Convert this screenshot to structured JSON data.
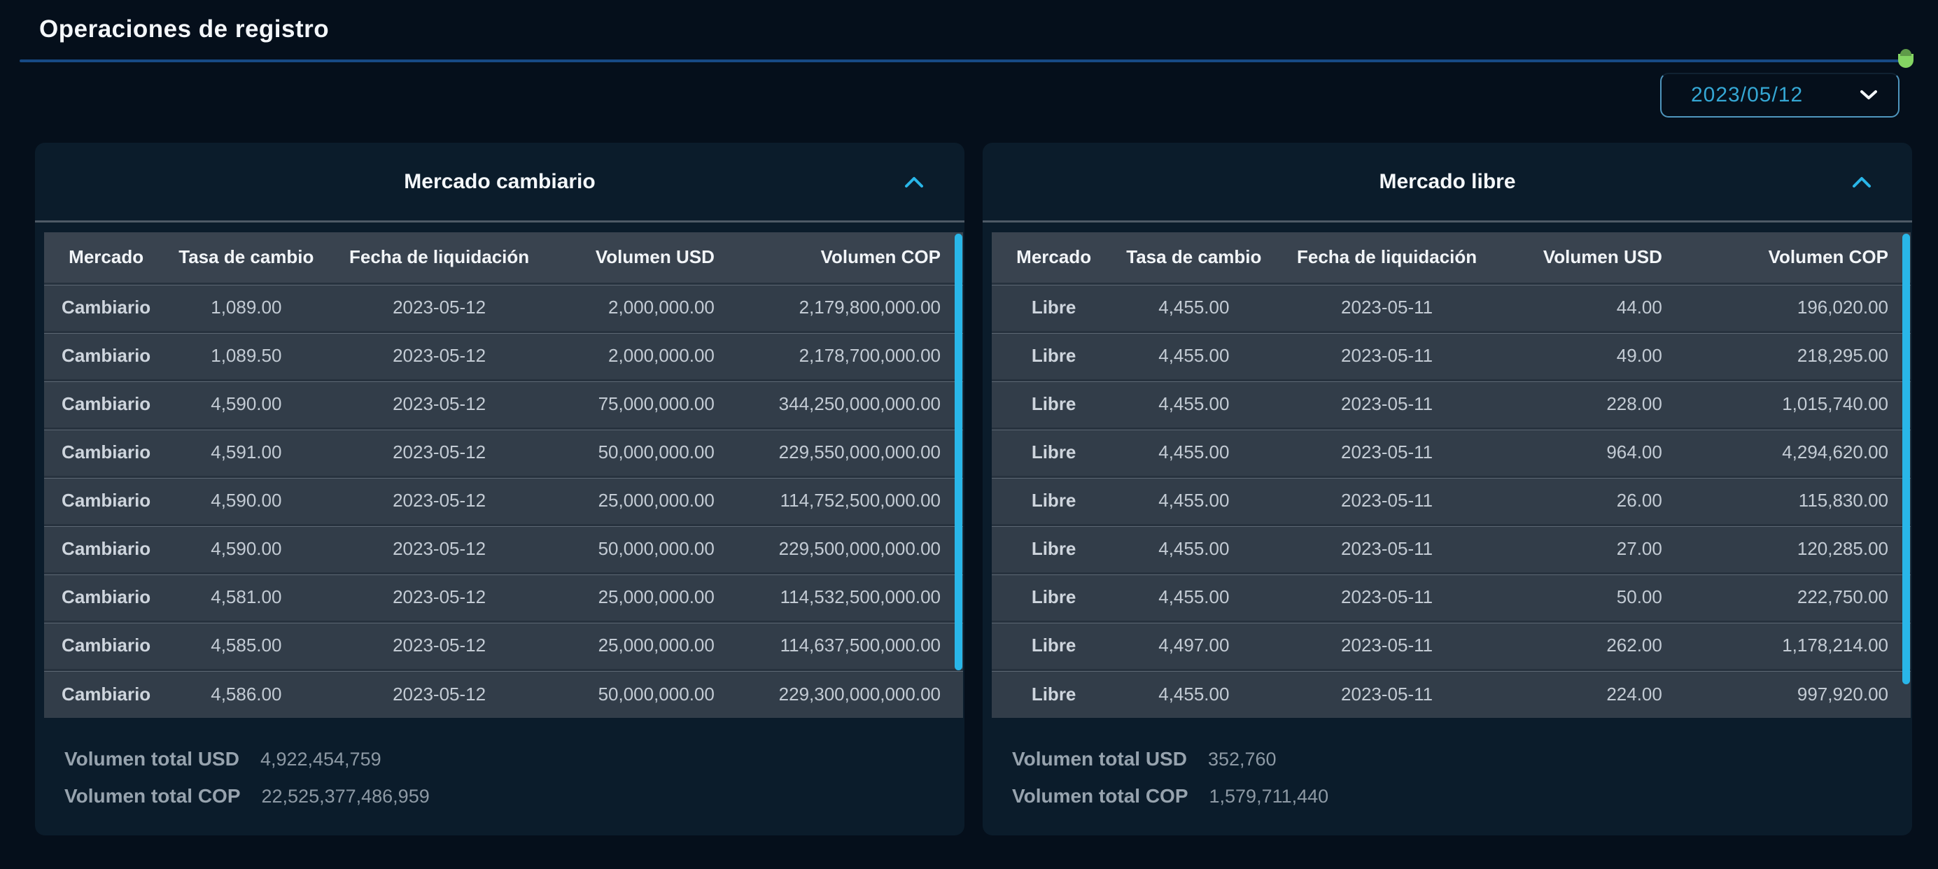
{
  "page": {
    "title": "Operaciones de registro"
  },
  "date_selector": {
    "value": "2023/05/12"
  },
  "columns": [
    "Mercado",
    "Tasa de cambio",
    "Fecha de liquidación",
    "Volumen USD",
    "Volumen COP"
  ],
  "panels": [
    {
      "title": "Mercado cambiario",
      "rows": [
        [
          "Cambiario",
          "1,089.00",
          "2023-05-12",
          "2,000,000.00",
          "2,179,800,000.00"
        ],
        [
          "Cambiario",
          "1,089.50",
          "2023-05-12",
          "2,000,000.00",
          "2,178,700,000.00"
        ],
        [
          "Cambiario",
          "4,590.00",
          "2023-05-12",
          "75,000,000.00",
          "344,250,000,000.00"
        ],
        [
          "Cambiario",
          "4,591.00",
          "2023-05-12",
          "50,000,000.00",
          "229,550,000,000.00"
        ],
        [
          "Cambiario",
          "4,590.00",
          "2023-05-12",
          "25,000,000.00",
          "114,752,500,000.00"
        ],
        [
          "Cambiario",
          "4,590.00",
          "2023-05-12",
          "50,000,000.00",
          "229,500,000,000.00"
        ],
        [
          "Cambiario",
          "4,581.00",
          "2023-05-12",
          "25,000,000.00",
          "114,532,500,000.00"
        ],
        [
          "Cambiario",
          "4,585.00",
          "2023-05-12",
          "25,000,000.00",
          "114,637,500,000.00"
        ],
        [
          "Cambiario",
          "4,586.00",
          "2023-05-12",
          "50,000,000.00",
          "229,300,000,000.00"
        ]
      ],
      "totals": {
        "usd_label": "Volumen total USD",
        "usd_value": "4,922,454,759",
        "cop_label": "Volumen total COP",
        "cop_value": "22,525,377,486,959"
      }
    },
    {
      "title": "Mercado libre",
      "rows": [
        [
          "Libre",
          "4,455.00",
          "2023-05-11",
          "44.00",
          "196,020.00"
        ],
        [
          "Libre",
          "4,455.00",
          "2023-05-11",
          "49.00",
          "218,295.00"
        ],
        [
          "Libre",
          "4,455.00",
          "2023-05-11",
          "228.00",
          "1,015,740.00"
        ],
        [
          "Libre",
          "4,455.00",
          "2023-05-11",
          "964.00",
          "4,294,620.00"
        ],
        [
          "Libre",
          "4,455.00",
          "2023-05-11",
          "26.00",
          "115,830.00"
        ],
        [
          "Libre",
          "4,455.00",
          "2023-05-11",
          "27.00",
          "120,285.00"
        ],
        [
          "Libre",
          "4,455.00",
          "2023-05-11",
          "50.00",
          "222,750.00"
        ],
        [
          "Libre",
          "4,497.00",
          "2023-05-11",
          "262.00",
          "1,178,214.00"
        ],
        [
          "Libre",
          "4,455.00",
          "2023-05-11",
          "224.00",
          "997,920.00"
        ]
      ],
      "totals": {
        "usd_label": "Volumen total USD",
        "usd_value": "352,760",
        "cop_label": "Volumen total COP",
        "cop_value": "1,579,711,440"
      }
    }
  ],
  "icons": {
    "panel_collapse": "chevron-up-icon",
    "date_dropdown": "chevron-down-icon"
  },
  "colors": {
    "accent_cyan": "#29b6e8",
    "date_text_cyan": "#35a7d4",
    "divider_blue": "#174a85",
    "green_indicator": "#84d563",
    "card_background": "#0b1c2b",
    "row_background": "#323d49",
    "header_row_background": "#39434f",
    "page_background": "#050f1b"
  }
}
